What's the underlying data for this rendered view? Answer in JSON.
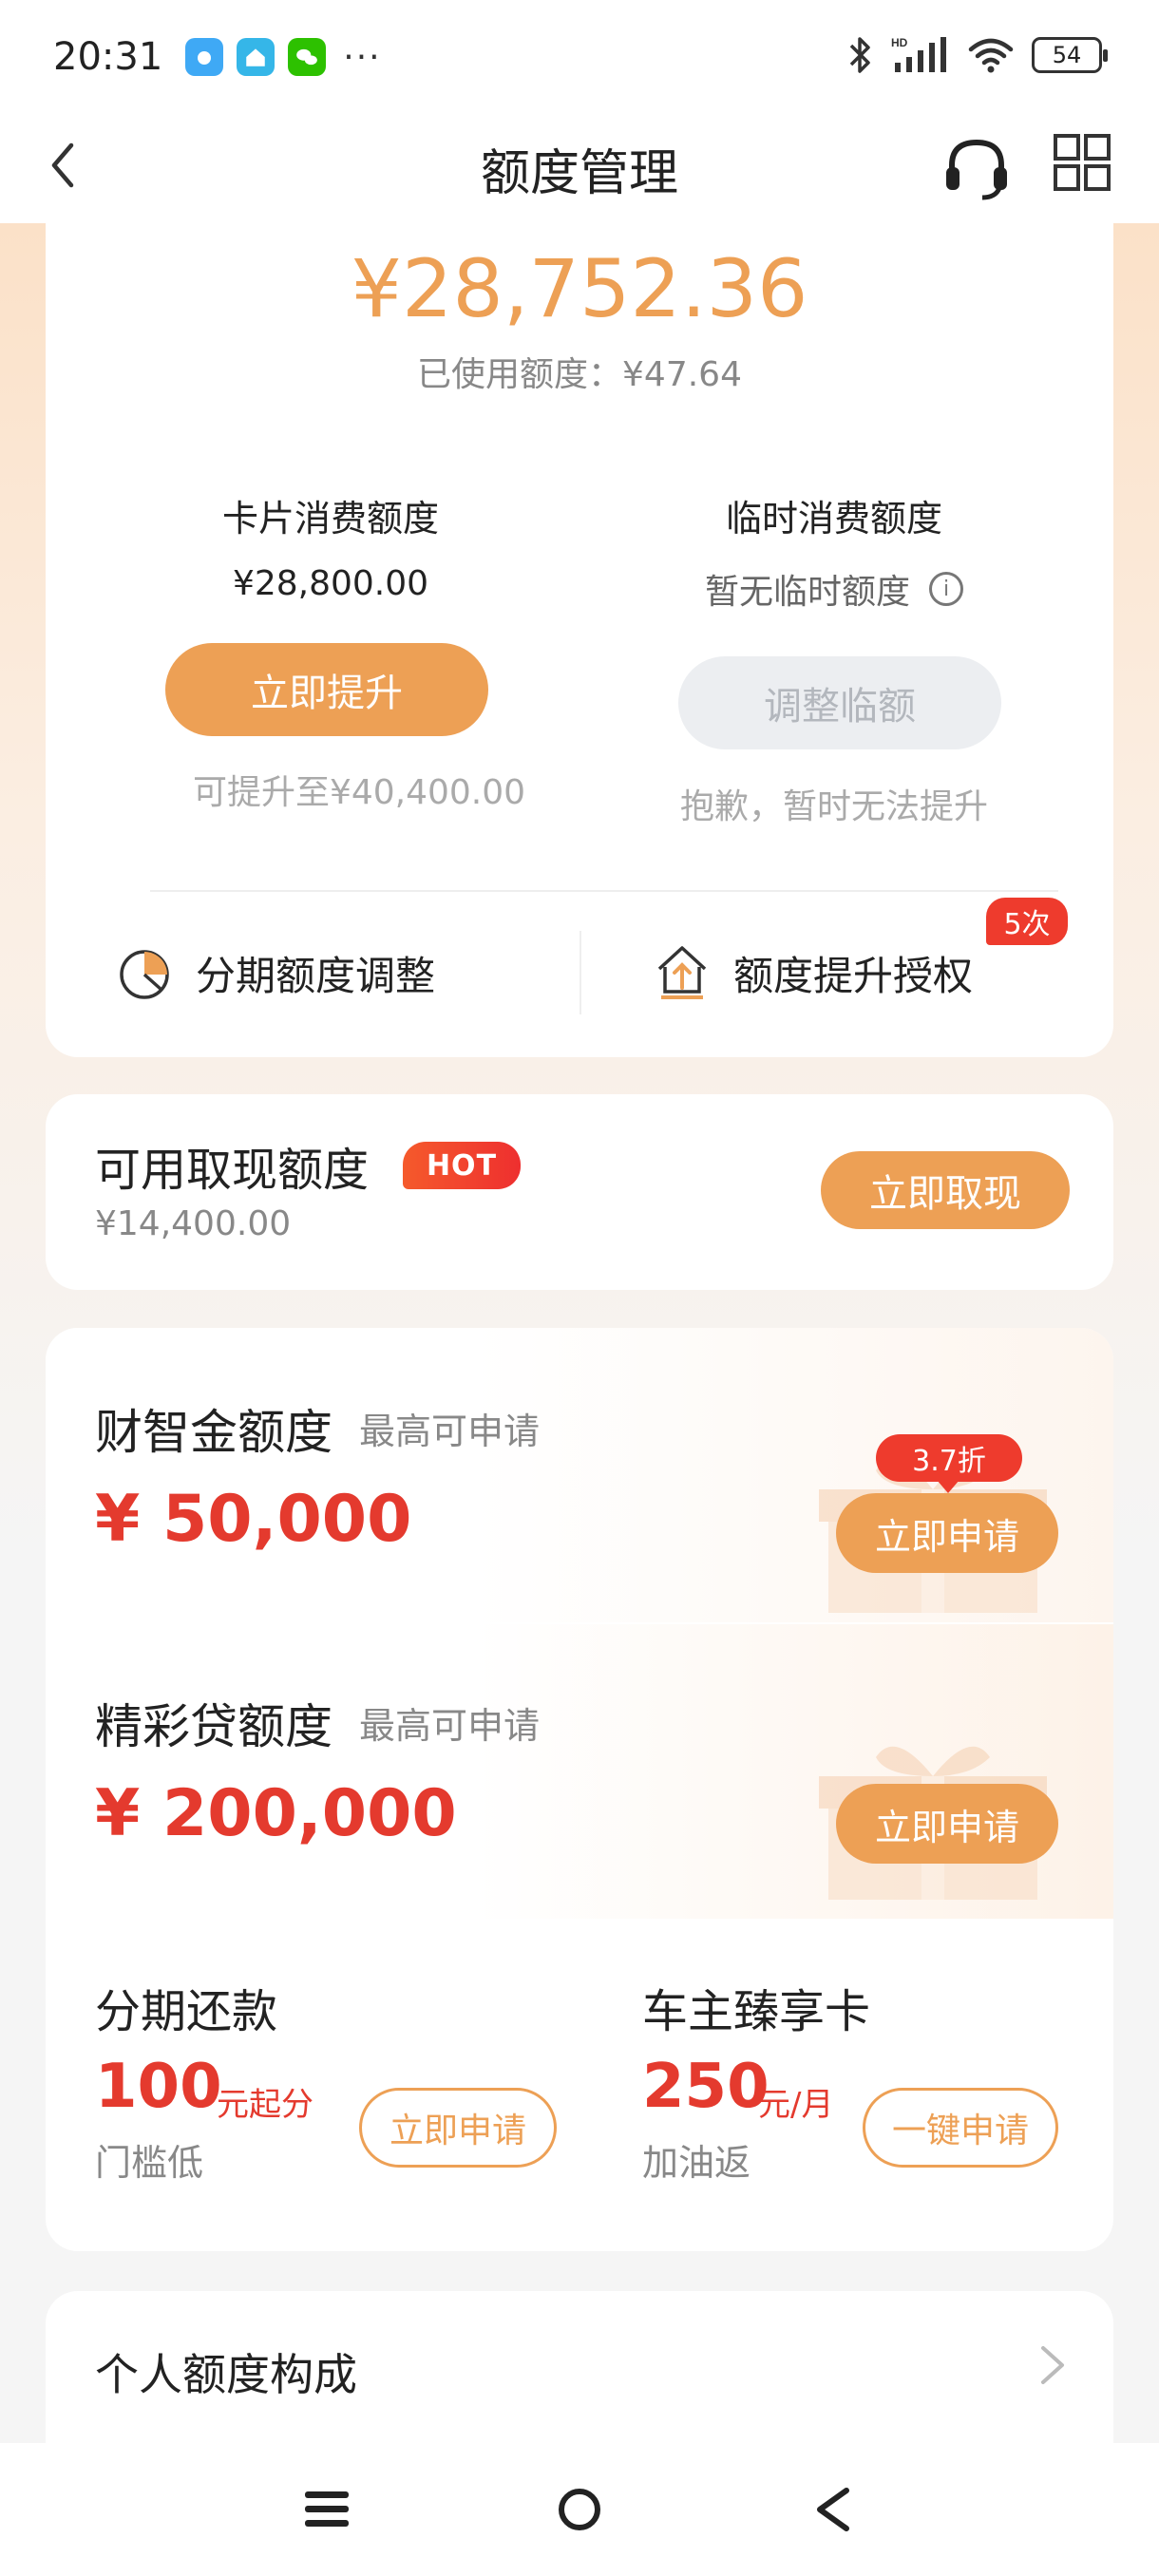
{
  "status_bar": {
    "time": "20:31",
    "more": "···",
    "network": "HD",
    "battery": "54"
  },
  "nav": {
    "title": "额度管理"
  },
  "credit": {
    "available_amount": "¥28,752.36",
    "used_amount": "已使用额度：¥47.64",
    "card_limit_title": "卡片消费额度",
    "card_limit_value": "¥28,800.00",
    "raise_button": "立即提升",
    "raise_note": "可提升至¥40,400.00",
    "temp_limit_title": "临时消费额度",
    "temp_limit_value": "暂无临时额度",
    "temp_button": "调整临额",
    "temp_note": "抱歉，暂时无法提升",
    "installment_adjust": "分期额度调整",
    "raise_authorization": "额度提升授权",
    "authorization_badge": "5次"
  },
  "cash": {
    "title": "可用取现额度",
    "hot_badge": "HOT",
    "amount": "¥14,400.00",
    "button": "立即取现"
  },
  "loans": [
    {
      "title": "财智金额度",
      "subtitle": "最高可申请",
      "amount": "¥ 50,000",
      "button": "立即申请",
      "badge": "3.7折"
    },
    {
      "title": "精彩贷额度",
      "subtitle": "最高可申请",
      "amount": "¥ 200,000",
      "button": "立即申请"
    }
  ],
  "installment": {
    "title": "分期还款",
    "number": "100",
    "unit": "元起分",
    "desc": "门槛低",
    "button": "立即申请"
  },
  "car_card": {
    "title": "车主臻享卡",
    "number": "250",
    "unit": "元/月",
    "desc": "加油返",
    "button": "一键申请"
  },
  "personal": {
    "title": "个人额度构成"
  },
  "colors": {
    "accent": "#eda055",
    "red": "#e43a2e",
    "badge_red": "#ee3b2d"
  }
}
